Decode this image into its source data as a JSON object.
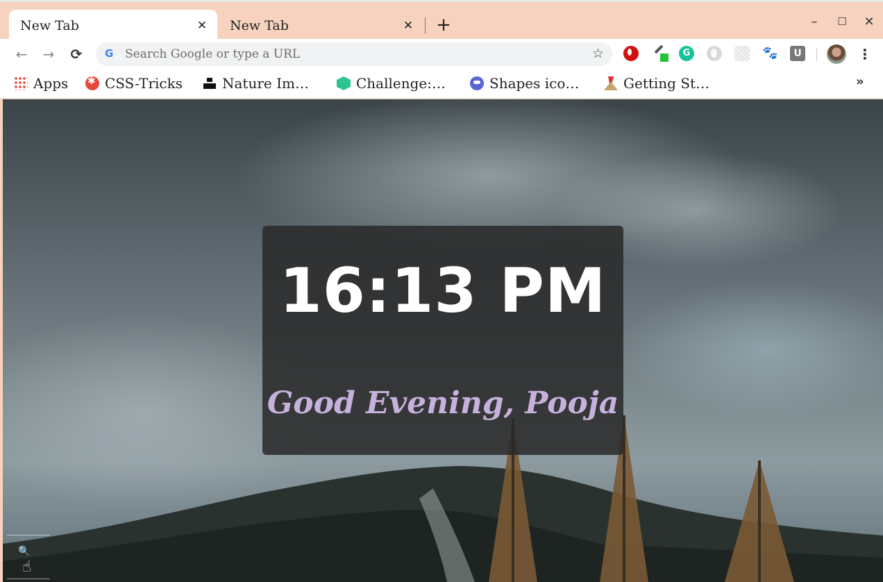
{
  "tabs": [
    {
      "title": "New Tab",
      "close": "✕",
      "active": true
    },
    {
      "title": "New Tab",
      "close": "✕",
      "active": false
    }
  ],
  "newtab_label": "+",
  "window_controls": {
    "minimize": "–",
    "maximize": "☐",
    "close": "✕"
  },
  "nav": {
    "back": "←",
    "forward": "→",
    "reload": "C"
  },
  "omnibox": {
    "google_icon": "G",
    "placeholder": "Search Google or type a URL",
    "value": "",
    "star": "☆"
  },
  "extensions": [
    {
      "icon": "opera-icon"
    },
    {
      "icon": "eyedropper-icon"
    },
    {
      "icon": "grammarly-icon",
      "glyph": "G"
    },
    {
      "icon": "gray-extension-icon"
    },
    {
      "icon": "dots-extension-icon"
    },
    {
      "icon": "paw-icon",
      "glyph": "🐾"
    },
    {
      "icon": "ublock-icon",
      "glyph": "U"
    }
  ],
  "menu_icon": "⋮",
  "bookmarks": [
    {
      "label": "Apps",
      "icon": "apps-grid-icon"
    },
    {
      "label": "CSS-Tricks",
      "icon": "css-tricks-icon"
    },
    {
      "label": "Nature Im…",
      "icon": "unsplash-icon"
    },
    {
      "label": "Challenge:…",
      "icon": "challenge-icon"
    },
    {
      "label": "Shapes ico…",
      "icon": "shapes-icon"
    },
    {
      "label": "Getting St…",
      "icon": "getting-started-icon"
    }
  ],
  "bookmarks_more": "»",
  "page": {
    "time": "16:13 PM",
    "greeting": "Good Evening, Pooja"
  },
  "cursor": {
    "hand": "☝",
    "tool": "🔍"
  },
  "colors": {
    "tabstrip": "#f7d3bf",
    "greeting": "#c5b1dc",
    "card": "#282828"
  }
}
